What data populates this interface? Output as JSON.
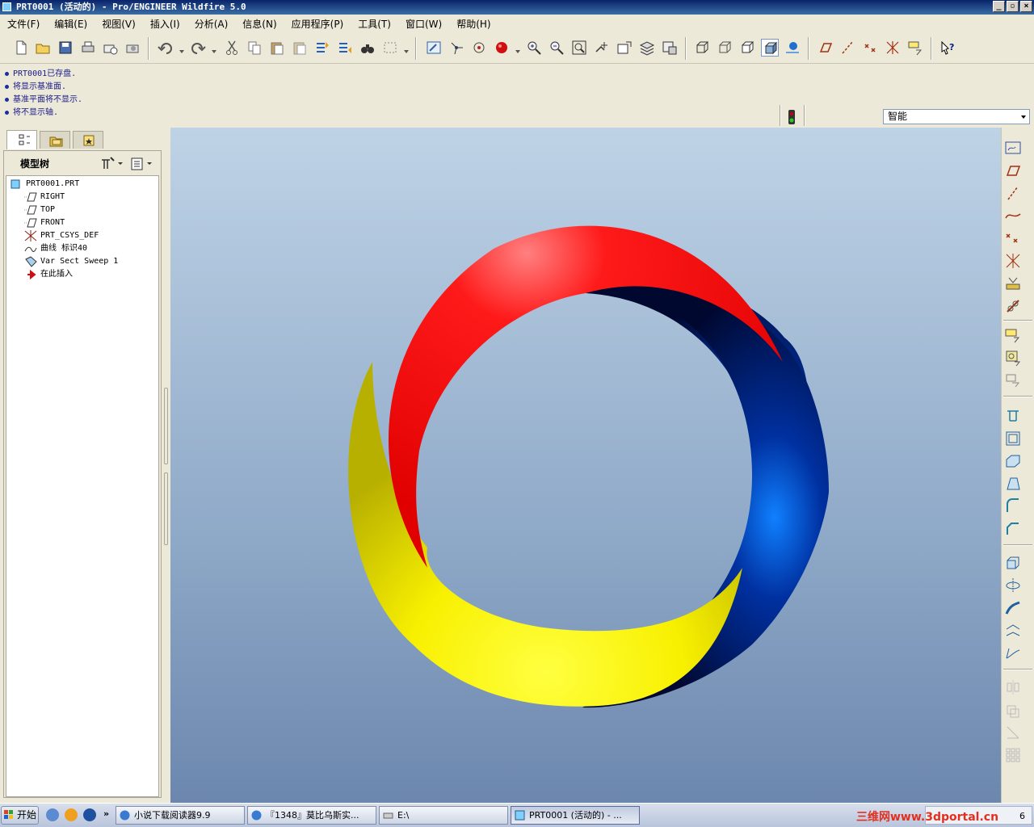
{
  "window": {
    "title": "PRT0001 (活动的) - Pro/ENGINEER Wildfire 5.0"
  },
  "menubar": [
    "文件(F)",
    "编辑(E)",
    "视图(V)",
    "插入(I)",
    "分析(A)",
    "信息(N)",
    "应用程序(P)",
    "工具(T)",
    "窗口(W)",
    "帮助(H)"
  ],
  "messages": [
    "PRT0001已存盘.",
    "将显示基准面.",
    "基准平面将不显示.",
    "将不显示轴."
  ],
  "filter": {
    "value": "智能"
  },
  "model_tree": {
    "title": "模型树",
    "nodes": [
      "PRT0001.PRT",
      "RIGHT",
      "TOP",
      "FRONT",
      "PRT_CSYS_DEF",
      "曲线 标识40",
      "Var Sect Sweep 1",
      "在此插入"
    ]
  },
  "taskbar": {
    "start": "开始",
    "tasks": [
      "小说下载阅读器9.9",
      "『1348』莫比乌斯实...",
      "E:\\",
      "PRT0001 (活动的) - ..."
    ],
    "watermark": "三维网www.3dportal.cn",
    "clock": "6"
  },
  "colors": {
    "red": "#ff0000",
    "yellow": "#ffff00",
    "navy": "#001a6a",
    "viewport_top": "#bfd3e6",
    "viewport_bottom": "#6c87ae"
  }
}
